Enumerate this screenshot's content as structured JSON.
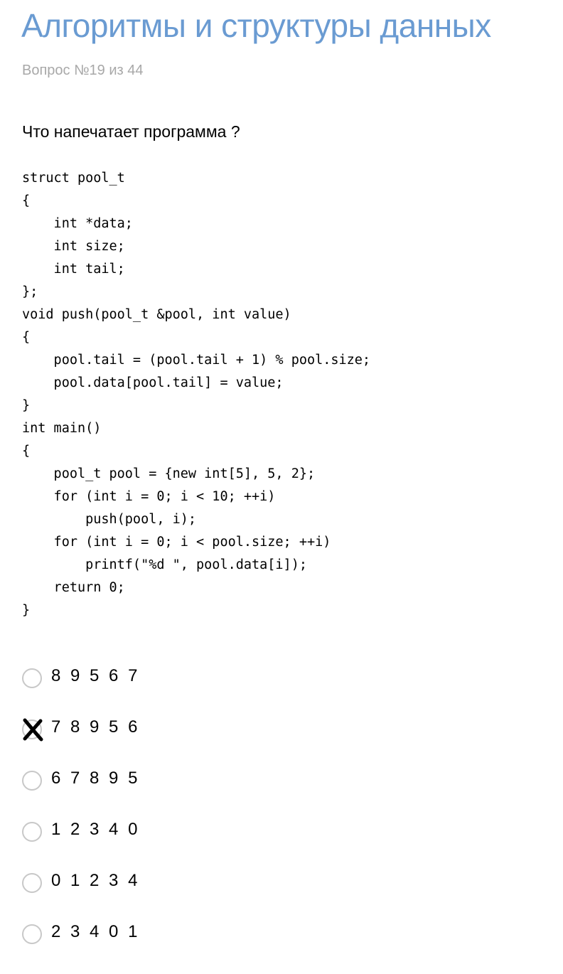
{
  "header": {
    "title": "Алгоритмы и структуры данных",
    "question_counter": "Вопрос №19 из 44"
  },
  "question": {
    "text": "Что напечатает программа ?",
    "code_lines": [
      "struct pool_t",
      "{",
      "    int *data;",
      "    int size;",
      "    int tail;",
      "};",
      "void push(pool_t &pool, int value)",
      "{",
      "    pool.tail = (pool.tail + 1) % pool.size;",
      "    pool.data[pool.tail] = value;",
      "}",
      "int main()",
      "{",
      "    pool_t pool = {new int[5], 5, 2};",
      "    for (int i = 0; i < 10; ++i)",
      "        push(pool, i);",
      "    for (int i = 0; i < pool.size; ++i)",
      "        printf(\"%d \", pool.data[i]);",
      "    return 0;",
      "}"
    ]
  },
  "answers": [
    {
      "label": "8 9 5 6 7",
      "marked": false
    },
    {
      "label": "7 8 9 5 6",
      "marked": true
    },
    {
      "label": "6 7 8 9 5",
      "marked": false
    },
    {
      "label": "1 2 3 4 0",
      "marked": false
    },
    {
      "label": "0 1 2 3 4",
      "marked": false
    },
    {
      "label": "2 3 4 0 1",
      "marked": false
    }
  ],
  "colors": {
    "title": "#6a9bd2",
    "counter": "#a8a8a8",
    "radio_border": "#c8c8c8",
    "mark": "#000000"
  },
  "icons": {
    "radio": "radio-circle",
    "mark": "x-mark-icon"
  }
}
